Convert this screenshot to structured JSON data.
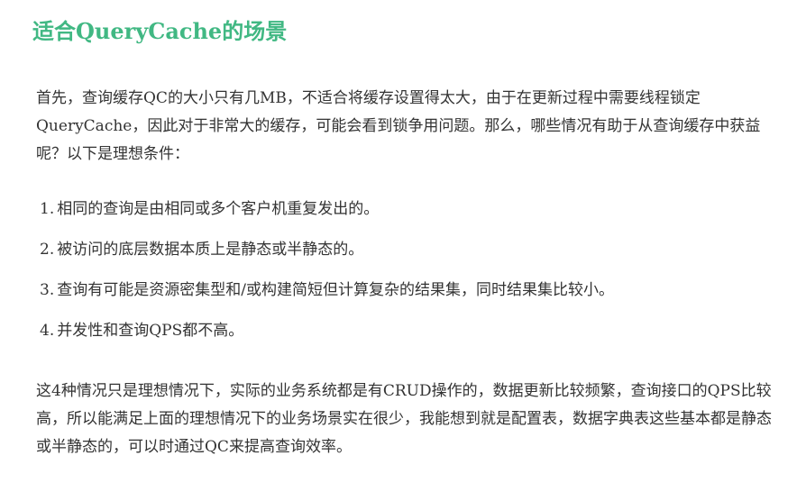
{
  "heading": "适合QueryCache的场景",
  "intro": "首先，查询缓存QC的大小只有几MB，不适合将缓存设置得太大，由于在更新过程中需要线程锁定QueryCache，因此对于非常大的缓存，可能会看到锁争用问题。那么，哪些情况有助于从查询缓存中获益呢？以下是理想条件：",
  "conditions": [
    {
      "num": "1.",
      "text": "相同的查询是由相同或多个客户机重复发出的。"
    },
    {
      "num": "2.",
      "text": "被访问的底层数据本质上是静态或半静态的。"
    },
    {
      "num": "3.",
      "text": "查询有可能是资源密集型和/或构建简短但计算复杂的结果集，同时结果集比较小。"
    },
    {
      "num": "4.",
      "text": "并发性和查询QPS都不高。"
    }
  ],
  "outro": "这4种情况只是理想情况下，实际的业务系统都是有CRUD操作的，数据更新比较频繁，查询接口的QPS比较高，所以能满足上面的理想情况下的业务场景实在很少，我能想到就是配置表，数据字典表这些基本都是静态或半静态的，可以时通过QC来提高查询效率。"
}
